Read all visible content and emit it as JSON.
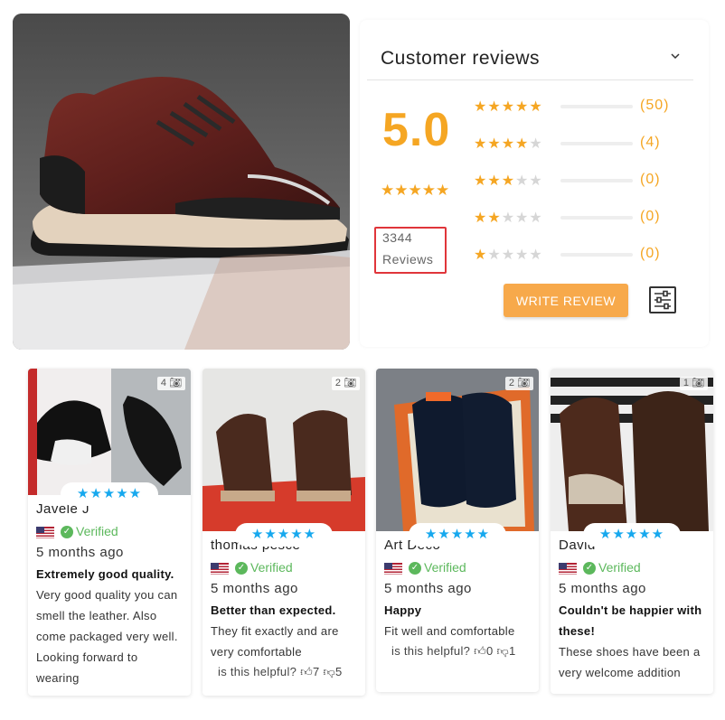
{
  "summary": {
    "title": "Customer reviews",
    "score": "5.0",
    "score_stars": "★★★★★",
    "reviews_count": "3344",
    "reviews_word": "Reviews",
    "rating_rows": [
      {
        "stars": 5,
        "count": "(50)"
      },
      {
        "stars": 4,
        "count": "(4)"
      },
      {
        "stars": 3,
        "count": "(0)"
      },
      {
        "stars": 2,
        "count": "(0)"
      },
      {
        "stars": 1,
        "count": "(0)"
      }
    ],
    "write_review_label": "WRITE REVIEW",
    "accent_color": "#f5a623"
  },
  "cards": [
    {
      "photo_count": "4",
      "stars": "★★★★★",
      "name": "Javele J",
      "verified": "Verified",
      "date": "5 months ago",
      "title": "Extremely good quality.",
      "text": "Very good quality you can smell the leather. Also come packaged very well. Looking forward to wearing"
    },
    {
      "photo_count": "2",
      "stars": "★★★★★",
      "name": "thomas pesce",
      "verified": "Verified",
      "date": "5 months ago",
      "title": "Better than expected.",
      "text": "They fit exactly and are very comfortable",
      "helpful": "is this helpful?",
      "likes": "7",
      "dislikes": "5"
    },
    {
      "photo_count": "2",
      "stars": "★★★★★",
      "name": "Art Deco",
      "verified": "Verified",
      "date": "5 months ago",
      "title": "Happy",
      "text": "Fit well and comfortable",
      "helpful": "is this helpful?",
      "likes": "0",
      "dislikes": "1"
    },
    {
      "photo_count": "1",
      "stars": "★★★★★",
      "name": "David",
      "verified": "Verified",
      "date": "5 months ago",
      "title": "Couldn't be happier with these!",
      "text": "These shoes have been a very welcome addition"
    }
  ]
}
